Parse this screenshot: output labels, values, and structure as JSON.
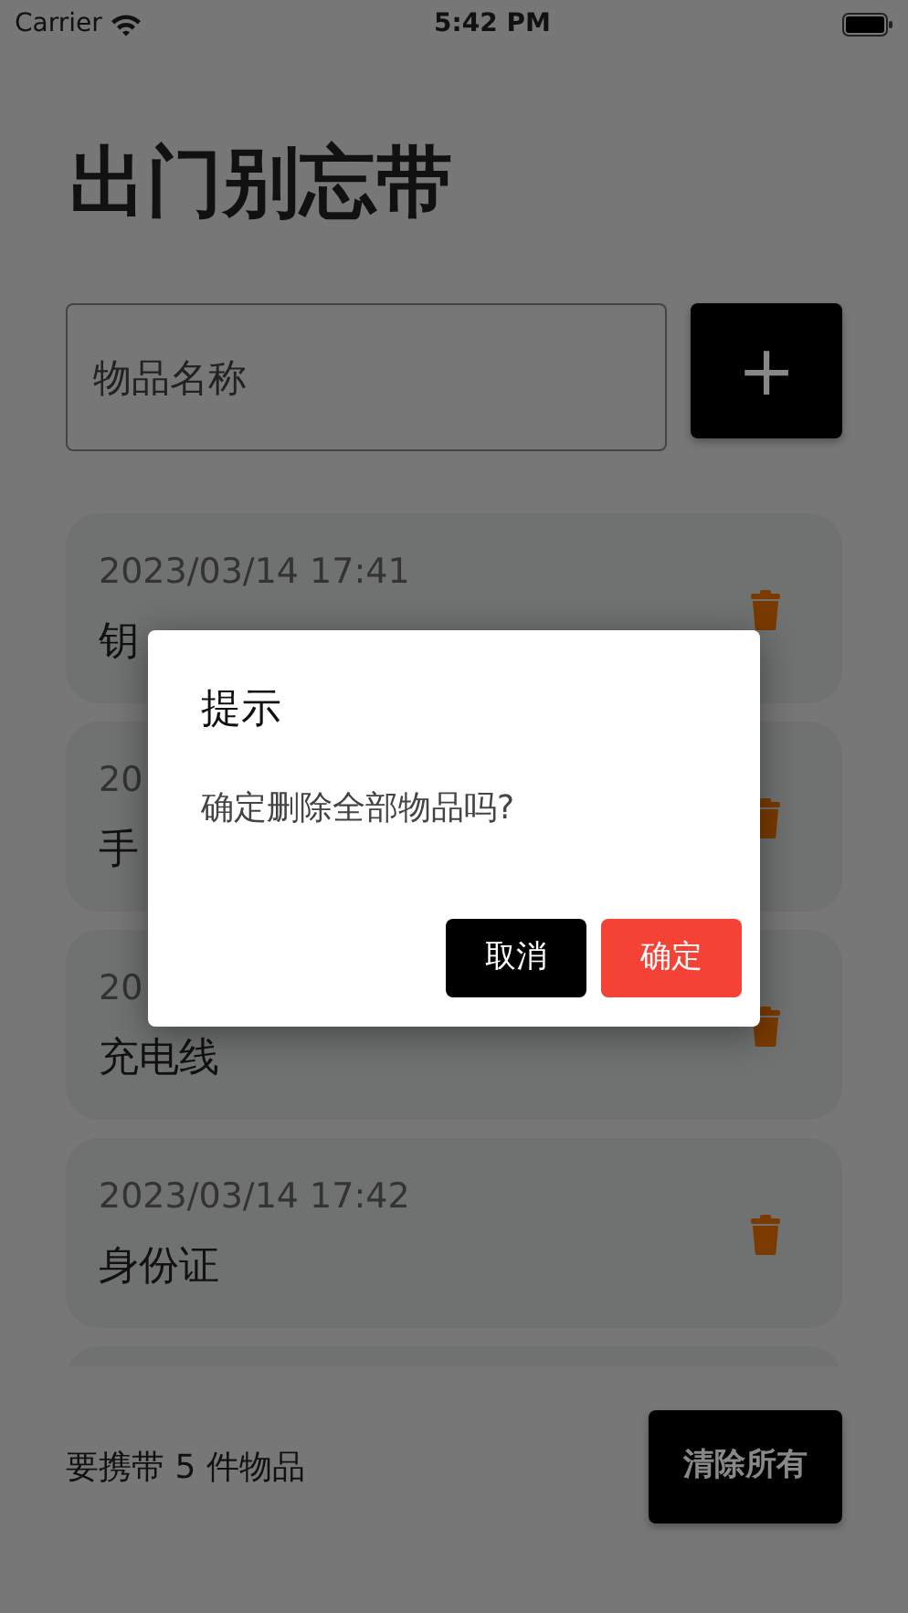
{
  "status_bar": {
    "carrier": "Carrier",
    "time": "5:42 PM"
  },
  "title": "出门别忘带",
  "input": {
    "placeholder": "物品名称"
  },
  "add_button": "+",
  "items": [
    {
      "date": "2023/03/14  17:41",
      "name": "钥"
    },
    {
      "date": "20",
      "name": "手"
    },
    {
      "date": "20",
      "name": "充电线"
    },
    {
      "date": "2023/03/14  17:42",
      "name": "身份证"
    }
  ],
  "footer": {
    "summary": "要携带 5 件物品",
    "clear_button": "清除所有"
  },
  "dialog": {
    "title": "提示",
    "message": "确定删除全部物品吗?",
    "buttons": [
      {
        "label": "取消",
        "kind": "cancel"
      },
      {
        "label": "确定",
        "kind": "confirm"
      }
    ]
  }
}
